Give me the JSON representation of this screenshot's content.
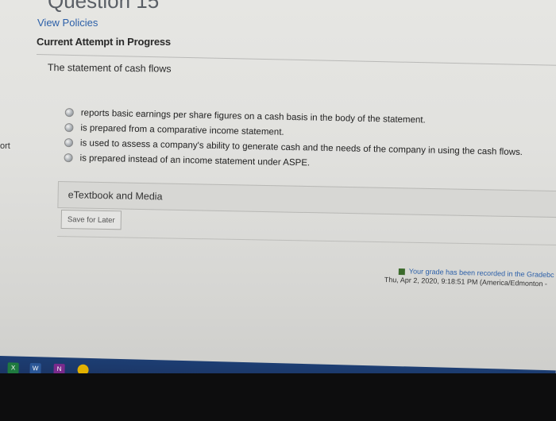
{
  "header": {
    "partial_heading": "Question 15",
    "view_policies": "View Policies",
    "current_attempt": "Current Attempt in Progress"
  },
  "left_edge_text": "ort",
  "question": {
    "text": "The statement of cash flows",
    "options": [
      "reports basic earnings per share figures on a cash basis in the body of the statement.",
      "is prepared from a comparative income statement.",
      "is used to assess a company's ability to generate cash and the needs of the company in using the cash flows.",
      "is prepared instead of an income statement under ASPE."
    ]
  },
  "etextbook_label": "eTextbook and Media",
  "save_label": "Save for Later",
  "grade": {
    "recorded": "Your grade has been recorded in the Gradebc",
    "timestamp": "Thu, Apr 2, 2020, 9:18:51 PM (America/Edmonton -"
  },
  "taskbar": {
    "icons": [
      {
        "name": "excel-icon",
        "label": "X",
        "color": "#1f7a3f"
      },
      {
        "name": "word-icon",
        "label": "W",
        "color": "#2b5797"
      },
      {
        "name": "onenote-icon",
        "label": "N",
        "color": "#7a2a8c"
      },
      {
        "name": "chrome-icon",
        "label": "",
        "color": "#e2b100"
      }
    ]
  }
}
